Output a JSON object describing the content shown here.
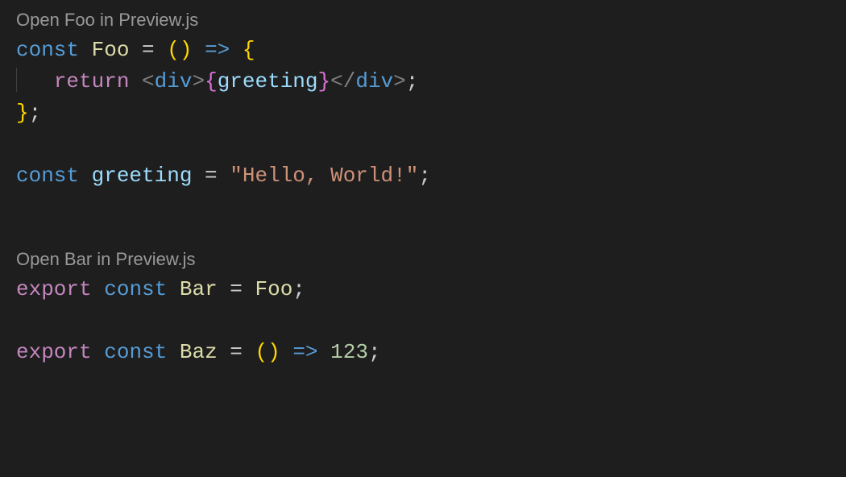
{
  "codelens": {
    "foo": "Open Foo in Preview.js",
    "bar": "Open Bar in Preview.js"
  },
  "code": {
    "const": "const",
    "return": "return",
    "export": "export",
    "foo": "Foo",
    "bar": "Bar",
    "baz": "Baz",
    "greeting": "greeting",
    "divOpen": "div",
    "divClose": "div",
    "stringVal": "\"Hello, World!\"",
    "num": "123",
    "eq": " = ",
    "arrow": "=>",
    "semi": ";",
    "ob": "{",
    "cb": "}",
    "op": "(",
    "cp": ")",
    "lt": "<",
    "gt": ">",
    "ltSlash": "</",
    "indent": "   "
  }
}
